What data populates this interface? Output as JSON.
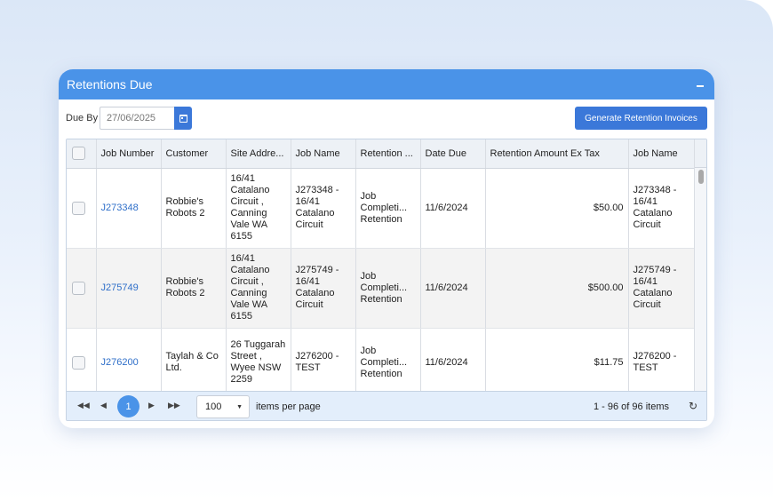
{
  "panel": {
    "title": "Retentions Due",
    "collapse_icon": "minimize-icon"
  },
  "toolbar": {
    "due_by_label": "Due By",
    "due_by_value": "27/06/2025",
    "calendar_icon": "calendar-icon",
    "generate_label": "Generate Retention Invoices",
    "accent_color": "#3b78d9",
    "header_color": "#4a93e8"
  },
  "table": {
    "columns": [
      "",
      "Job Number",
      "Customer",
      "Site Addre...",
      "Job Name",
      "Retention ...",
      "Date Due",
      "Retention Amount Ex Tax",
      "Job Name"
    ],
    "rows": [
      {
        "job_number": "J273348",
        "customer": "Robbie's Robots 2",
        "site_address": "16/41 Catalano Circuit , Canning Vale WA 6155",
        "job_name": "J273348 - 16/41 Catalano Circuit",
        "retention": "Job Completi... Retention",
        "date_due": "11/6/2024",
        "amount": "$50.00",
        "job_name_2": "J273348 - 16/41 Catalano Circuit"
      },
      {
        "job_number": "J275749",
        "customer": "Robbie's Robots 2",
        "site_address": "16/41 Catalano Circuit , Canning Vale WA 6155",
        "job_name": "J275749 - 16/41 Catalano Circuit",
        "retention": "Job Completi... Retention",
        "date_due": "11/6/2024",
        "amount": "$500.00",
        "job_name_2": "J275749 - 16/41 Catalano Circuit"
      },
      {
        "job_number": "J276200",
        "customer": "Taylah & Co Ltd.",
        "site_address": "26 Tuggarah Street , Wyee NSW 2259",
        "job_name": "J276200 - TEST",
        "retention": "Job Completi... Retention",
        "date_due": "11/6/2024",
        "amount": "$11.75",
        "job_name_2": "J276200 - TEST"
      }
    ]
  },
  "pager": {
    "current_page": "1",
    "page_size": "100",
    "items_per_page_label": "items per page",
    "info": "1 - 96 of 96 items",
    "icons": [
      "first-page-icon",
      "prev-page-icon",
      "next-page-icon",
      "last-page-icon",
      "refresh-icon"
    ]
  }
}
